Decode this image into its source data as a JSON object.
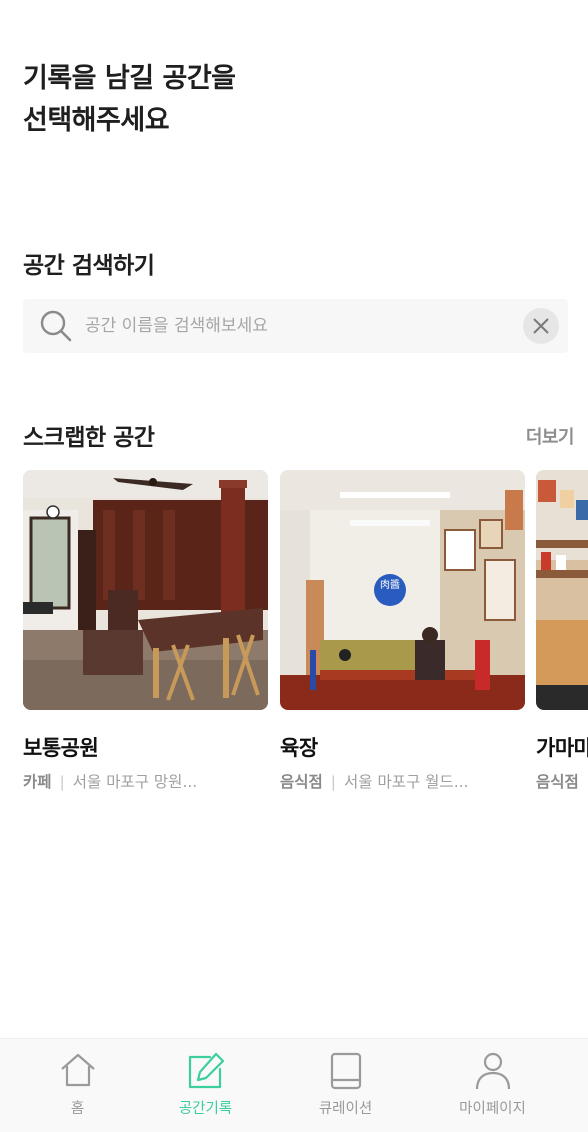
{
  "header": {
    "title_line1": "기록을 남길 공간을",
    "title_line2": "선택해주세요"
  },
  "search": {
    "section_title": "공간 검색하기",
    "placeholder": "공간 이름을 검색해보세요",
    "value": ""
  },
  "scraps": {
    "section_title": "스크랩한 공간",
    "more_label": "더보기",
    "items": [
      {
        "name": "보통공원",
        "category": "카페",
        "address": "서울 마포구 망원..."
      },
      {
        "name": "육장",
        "category": "음식점",
        "address": "서울 마포구 월드..."
      },
      {
        "name": "가마마",
        "category": "음식점",
        "address": ""
      }
    ],
    "separator": "|"
  },
  "tabbar": {
    "items": [
      {
        "label": "홈",
        "icon": "home-icon"
      },
      {
        "label": "공간기록",
        "icon": "edit-note-icon"
      },
      {
        "label": "큐레이션",
        "icon": "book-icon"
      },
      {
        "label": "마이페이지",
        "icon": "person-icon"
      }
    ],
    "active_index": 1,
    "active_color": "#3ccf9b",
    "inactive_color": "#9a9a9a"
  },
  "sign_text": "肉醬"
}
